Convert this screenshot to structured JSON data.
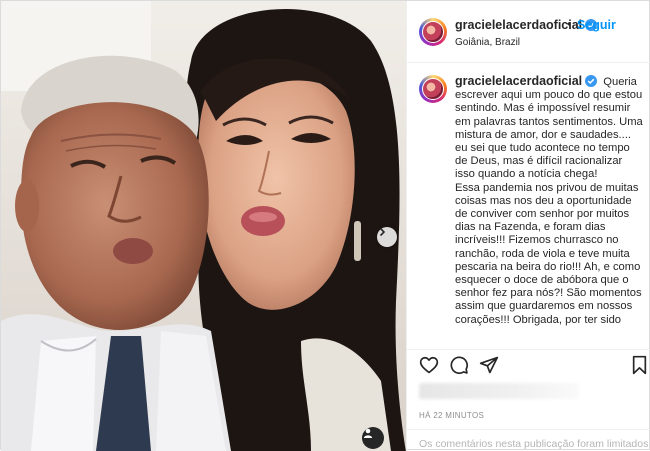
{
  "post": {
    "username": "gracielelacerdaoficial",
    "separator": "•",
    "follow_label": "Seguir",
    "location": "Goiânia, Brazil",
    "caption": "Queria escrever aqui um pouco do que estou sentindo. Mas é impossível resumir em palavras tantos sentimentos. Uma mistura de amor, dor e saudades.... eu sei que tudo acontece no tempo de Deus, mas é difícil racionalizar isso quando a notícia chega!",
    "caption_2": "Essa pandemia nos privou de muitas coisas mas nos deu a oportunidade de conviver com senhor por muitos dias na Fazenda, e foram dias incríveis!!! Fizemos churrasco no ranchão, roda de viola e teve muita pescaria na beira do rio!!! Ah, e como esquecer o doce de abóbora que o senhor fez para nós?! São momentos assim que guardaremos em nossos corações!!! Obrigada, por ter sido",
    "time_ago": "HÁ 22 MINUTOS",
    "comments_notice": "Os comentários nesta publicação foram limitados"
  },
  "icons": {
    "verified": "verified-badge-icon",
    "like": "heart-icon",
    "comment": "comment-icon",
    "share": "paper-plane-icon",
    "save": "bookmark-icon",
    "next": "chevron-right-icon",
    "tag": "person-tag-icon"
  },
  "colors": {
    "accent": "#0095f6",
    "verified": "#3897f0",
    "muted": "#8e8e8e"
  }
}
